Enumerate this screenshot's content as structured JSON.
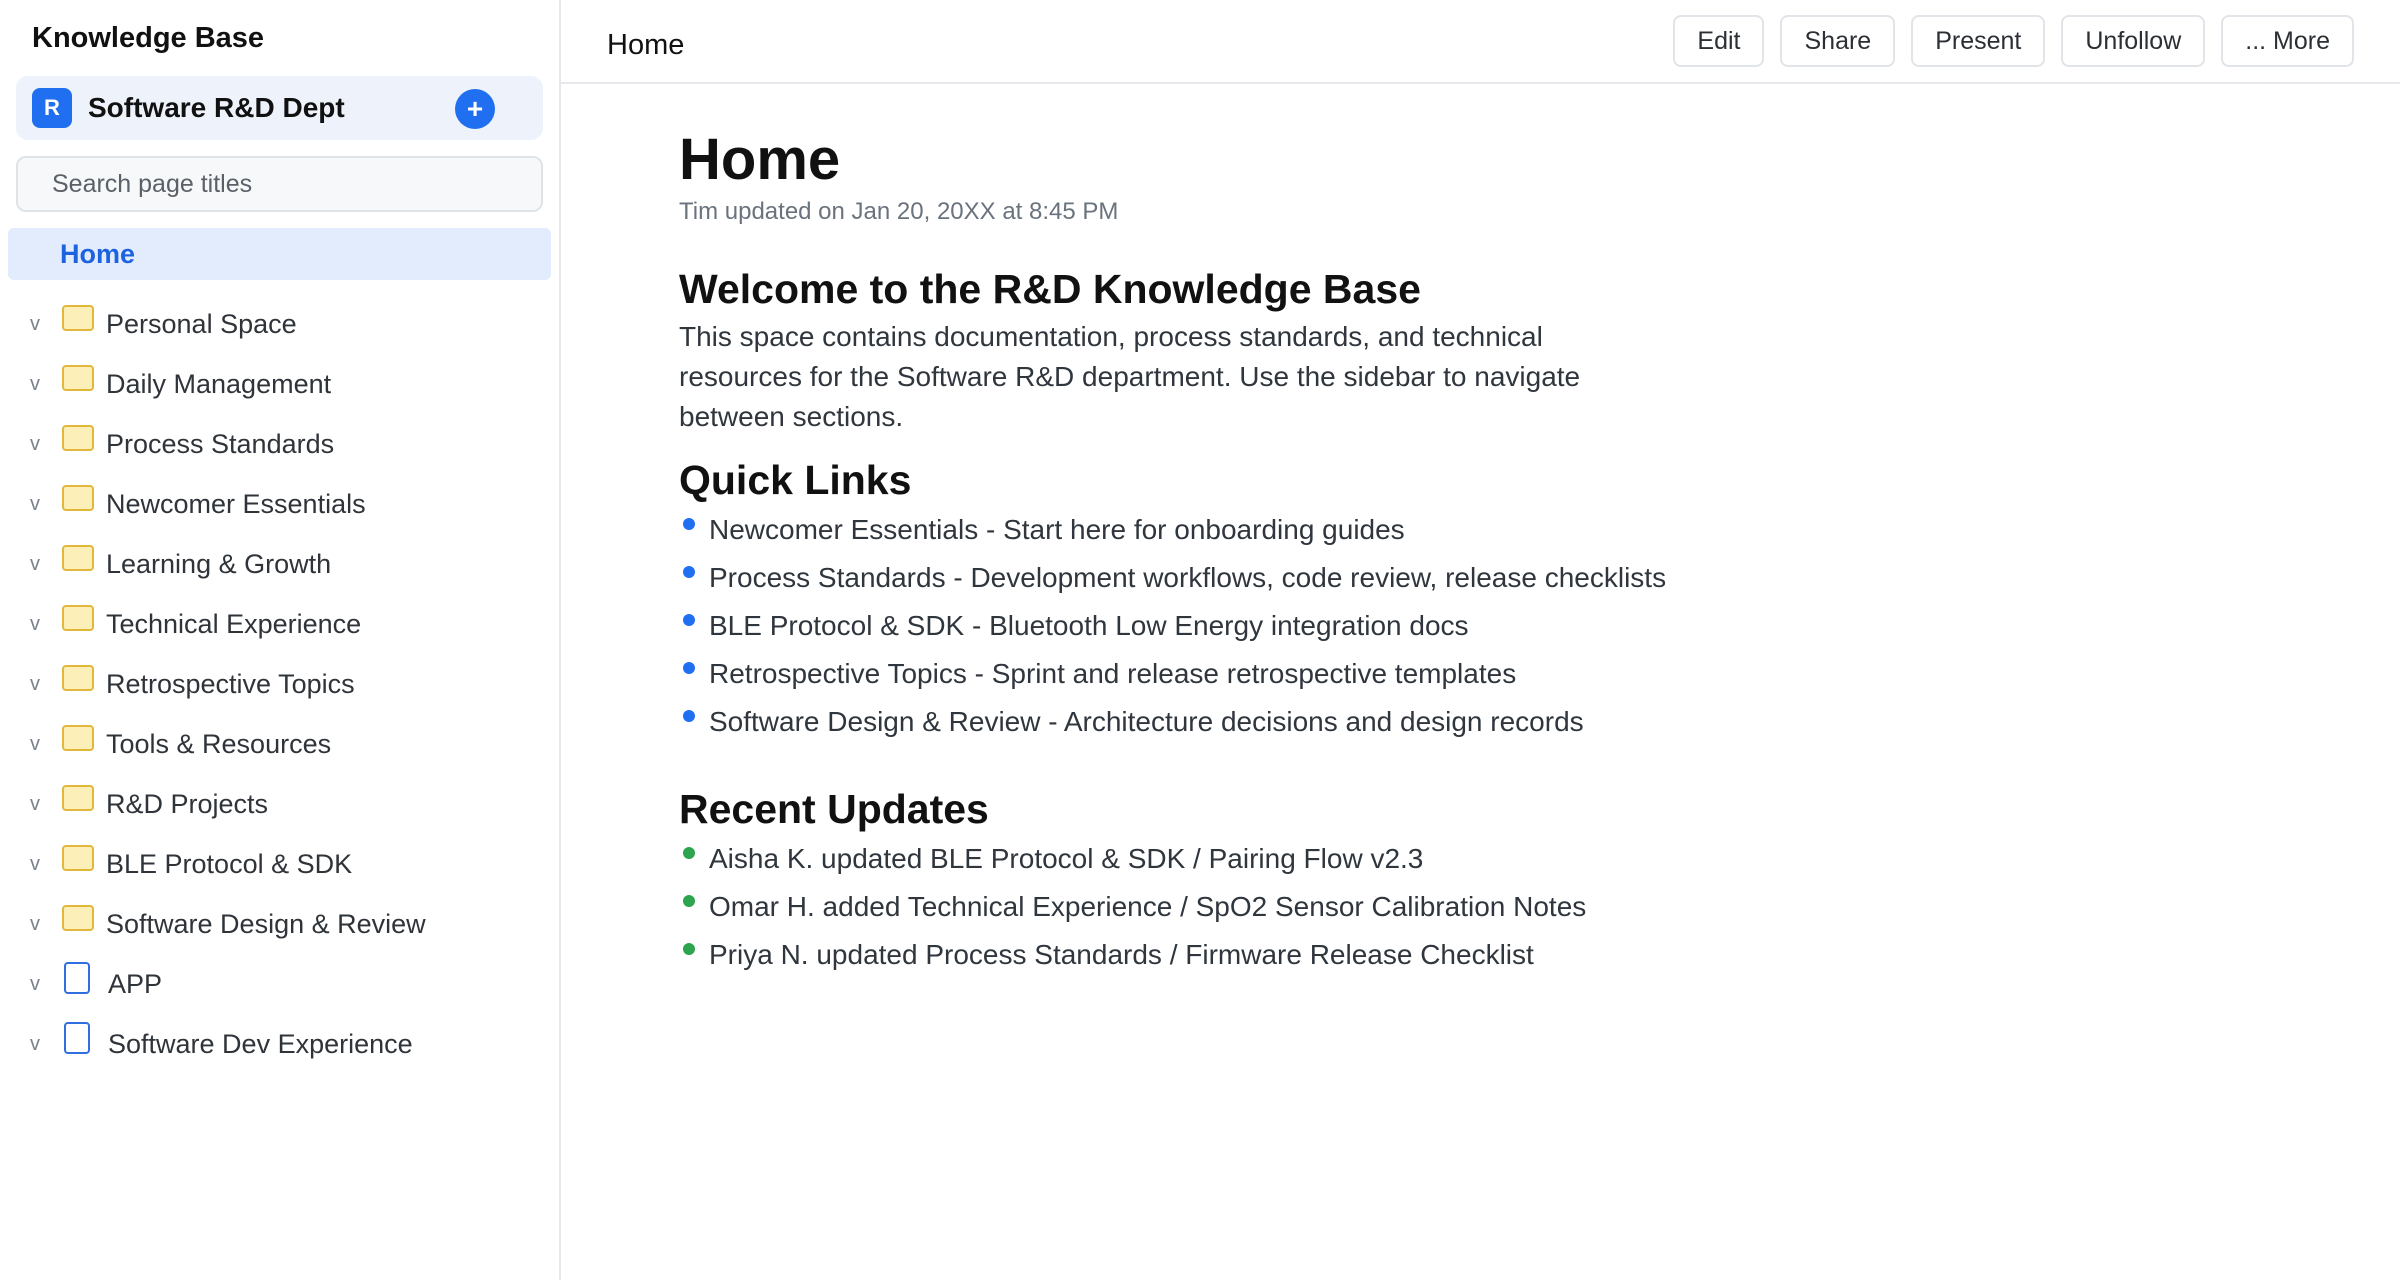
{
  "sidebar": {
    "title": "Knowledge Base",
    "space": {
      "avatar": "R",
      "name": "Software R&D Dept",
      "add_label": "+"
    },
    "search_placeholder": "Search page titles",
    "home": "Home",
    "items": [
      {
        "label": "Personal Space",
        "icon": "folder-icon"
      },
      {
        "label": "Daily Management",
        "icon": "folder-icon"
      },
      {
        "label": "Process Standards",
        "icon": "folder-icon"
      },
      {
        "label": "Newcomer Essentials",
        "icon": "folder-icon"
      },
      {
        "label": "Learning & Growth",
        "icon": "folder-icon"
      },
      {
        "label": "Technical Experience",
        "icon": "folder-icon"
      },
      {
        "label": "Retrospective Topics",
        "icon": "folder-icon"
      },
      {
        "label": "Tools & Resources",
        "icon": "folder-icon"
      },
      {
        "label": "R&D Projects",
        "icon": "folder-icon"
      },
      {
        "label": "BLE Protocol & SDK",
        "icon": "folder-icon"
      },
      {
        "label": "Software Design & Review",
        "icon": "folder-icon"
      },
      {
        "label": "APP",
        "icon": "page-icon"
      },
      {
        "label": "Software Dev Experience",
        "icon": "page-icon"
      }
    ],
    "chevron": "v"
  },
  "topbar": {
    "breadcrumb": "Home",
    "buttons": {
      "edit": "Edit",
      "share": "Share",
      "present": "Present",
      "unfollow": "Unfollow",
      "more": "... More"
    }
  },
  "page": {
    "title": "Home",
    "meta": "Tim updated on Jan 20, 20XX at 8:45 PM",
    "welcome_heading": "Welcome to the R&D Knowledge Base",
    "intro": "This space contains documentation, process standards, and technical resources for the Software R&D department. Use the sidebar to navigate between sections.",
    "quick_links_heading": "Quick Links",
    "quick_links": [
      "Newcomer Essentials - Start here for onboarding guides",
      "Process Standards - Development workflows, code review, release checklists",
      "BLE Protocol & SDK - Bluetooth Low Energy integration docs",
      "Retrospective Topics - Sprint and release retrospective templates",
      "Software Design & Review - Architecture decisions and design records"
    ],
    "recent_heading": "Recent Updates",
    "recent_updates": [
      "Aisha K. updated BLE Protocol & SDK / Pairing Flow v2.3",
      "Omar H. added Technical Experience / SpO2 Sensor Calibration Notes",
      "Priya N. updated Process Standards / Firmware Release Checklist"
    ]
  },
  "colors": {
    "accent": "#1f6ff0",
    "folder": "#fdefb8",
    "recent_dot": "#2da44e"
  }
}
